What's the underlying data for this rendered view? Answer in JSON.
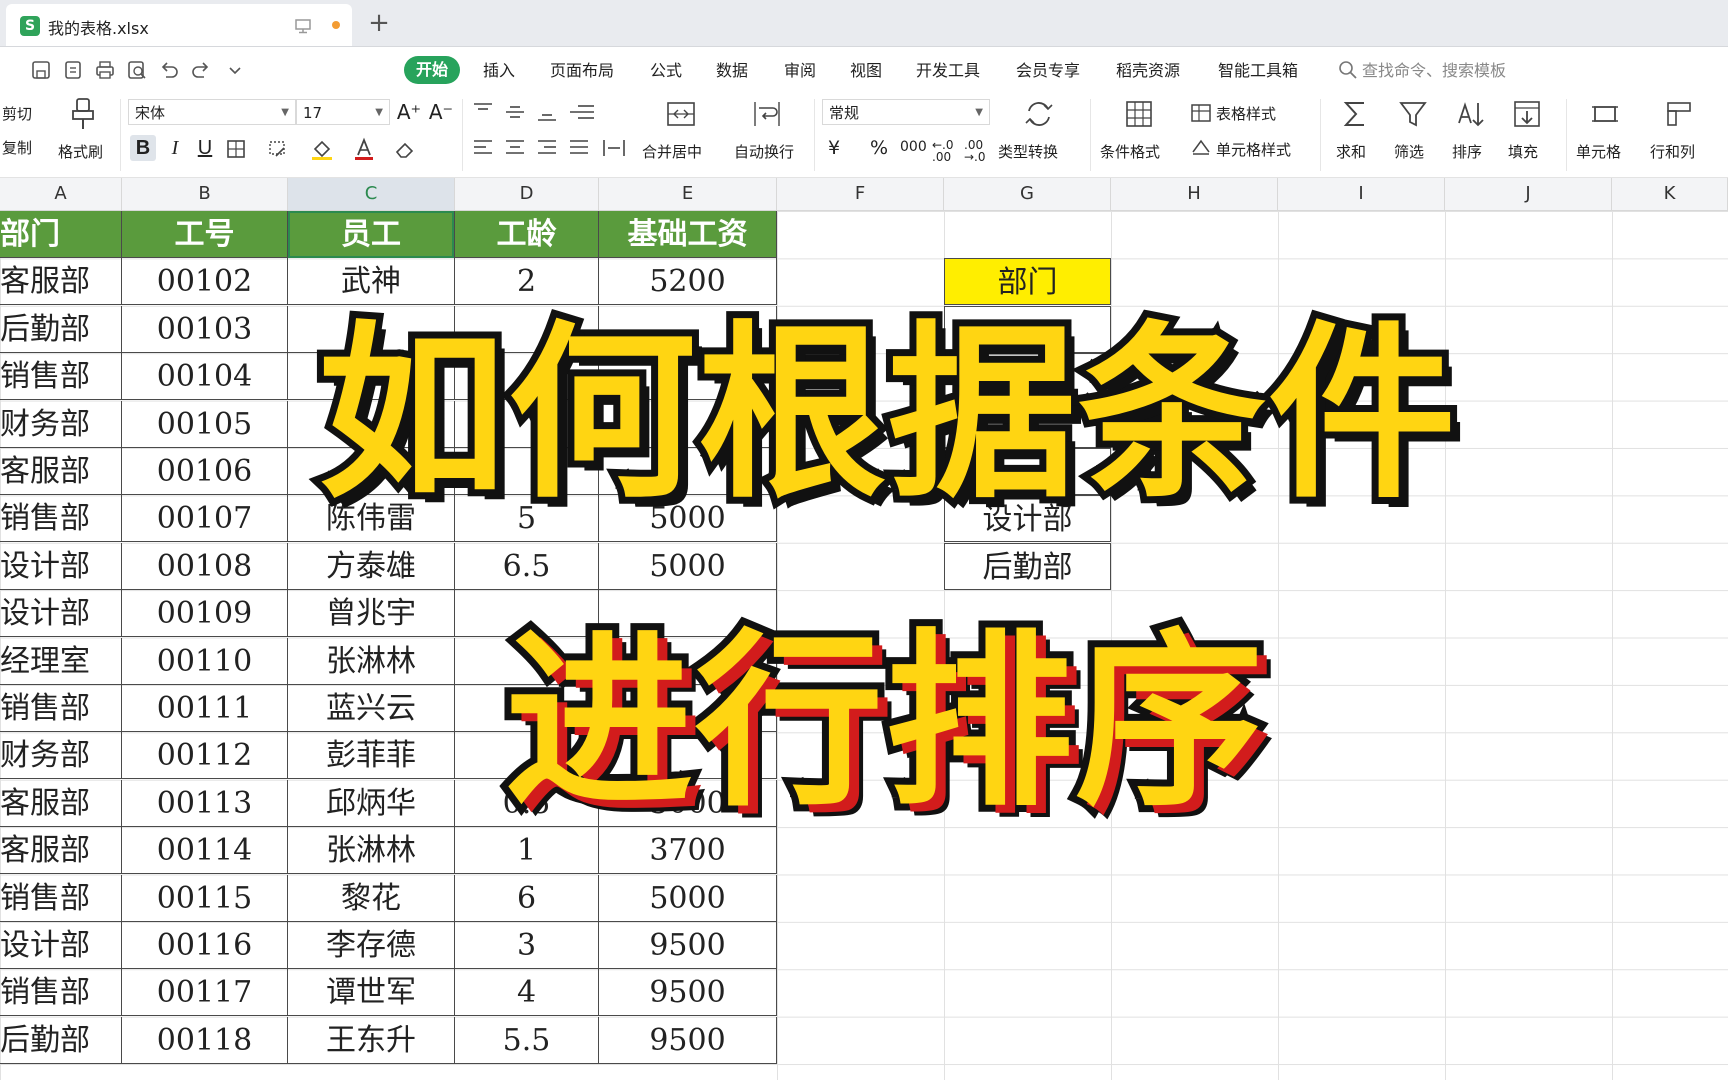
{
  "window": {
    "tab_title": "我的表格.xlsx",
    "app_logo": "S",
    "new_tab_label": "+"
  },
  "menu": {
    "items": [
      "开始",
      "插入",
      "页面布局",
      "公式",
      "数据",
      "审阅",
      "视图",
      "开发工具",
      "会员专享",
      "稻壳资源",
      "智能工具箱"
    ],
    "search_placeholder": "查找命令、搜索模板"
  },
  "ribbon": {
    "cut": "剪切",
    "copy": "复制",
    "format_painter": "格式刷",
    "font_name": "宋体",
    "font_size": "17",
    "bold": "B",
    "italic": "I",
    "underline": "U",
    "merge_center": "合并居中",
    "wrap_text": "自动换行",
    "number_format": "常规",
    "type_convert": "类型转换",
    "conditional_format": "条件格式",
    "table_style": "表格样式",
    "cell_style": "单元格样式",
    "sum": "求和",
    "filter": "筛选",
    "sort": "排序",
    "fill": "填充",
    "cell": "单元格",
    "row_col": "行和列",
    "currency": "¥",
    "percent": "%",
    "thousands": "000",
    "inc_decimal": "←.0 .00",
    "dec_decimal": ".00 →.0"
  },
  "columns": [
    "A",
    "B",
    "C",
    "D",
    "E",
    "F",
    "G",
    "H",
    "I",
    "J",
    "K"
  ],
  "selected_column": "C",
  "table": {
    "headers": [
      "部门",
      "工号",
      "员工",
      "工龄",
      "基础工资"
    ],
    "rows": [
      [
        "客服部",
        "00102",
        "武神",
        "2",
        "5200"
      ],
      [
        "后勤部",
        "00103",
        "",
        "",
        ""
      ],
      [
        "销售部",
        "00104",
        "",
        "",
        ""
      ],
      [
        "财务部",
        "00105",
        "",
        "",
        ""
      ],
      [
        "客服部",
        "00106",
        "",
        "",
        ""
      ],
      [
        "销售部",
        "00107",
        "陈伟雷",
        "5",
        "5000"
      ],
      [
        "设计部",
        "00108",
        "方泰雄",
        "6.5",
        "5000"
      ],
      [
        "设计部",
        "00109",
        "曾兆宇",
        "",
        ""
      ],
      [
        "经理室",
        "00110",
        "张淋林",
        "",
        ""
      ],
      [
        "销售部",
        "00111",
        "蓝兴云",
        "",
        ""
      ],
      [
        "财务部",
        "00112",
        "彭菲菲",
        "",
        ""
      ],
      [
        "客服部",
        "00113",
        "邱炳华",
        "0.5",
        "5000"
      ],
      [
        "客服部",
        "00114",
        "张淋林",
        "1",
        "3700"
      ],
      [
        "销售部",
        "00115",
        "黎花",
        "6",
        "5000"
      ],
      [
        "设计部",
        "00116",
        "李存德",
        "3",
        "9500"
      ],
      [
        "销售部",
        "00117",
        "谭世军",
        "4",
        "9500"
      ],
      [
        "后勤部",
        "00118",
        "王东升",
        "5.5",
        "9500"
      ]
    ]
  },
  "sort_list": {
    "header": "部门",
    "items": [
      "设计部",
      "后勤部"
    ]
  },
  "overlay": {
    "line1": "如何根据条件",
    "line2": "进行排序"
  },
  "colors": {
    "header_green": "#5a9b3d",
    "accent_green": "#27a35c",
    "sort_header_yellow": "#ffee00",
    "overlay_yellow": "#ffd512",
    "overlay_red": "#d21c1c"
  }
}
